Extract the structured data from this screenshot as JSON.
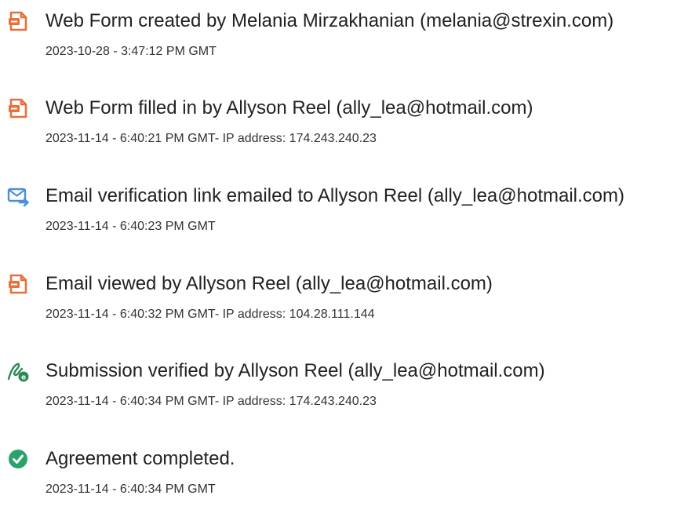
{
  "colors": {
    "doc_icon": "#e8703a",
    "email_icon": "#4a90d9",
    "verify_icon": "#2e8b57",
    "complete_icon": "#29a36a",
    "text": "#222222"
  },
  "events": [
    {
      "icon": "document-icon",
      "title": "Web Form created by Melania Mirzakhanian (melania@strexin.com)",
      "meta": "2023-10-28 - 3:47:12 PM GMT"
    },
    {
      "icon": "document-icon",
      "title": "Web Form filled in by Allyson Reel (ally_lea@hotmail.com)",
      "meta": "2023-11-14 - 6:40:21 PM GMT- IP address: 174.243.240.23"
    },
    {
      "icon": "email-send-icon",
      "title": "Email verification link emailed to Allyson Reel (ally_lea@hotmail.com)",
      "meta": "2023-11-14 - 6:40:23 PM GMT"
    },
    {
      "icon": "document-icon",
      "title": "Email viewed by Allyson Reel (ally_lea@hotmail.com)",
      "meta": "2023-11-14 - 6:40:32 PM GMT- IP address: 104.28.111.144"
    },
    {
      "icon": "signature-verified-icon",
      "title": "Submission verified by Allyson Reel (ally_lea@hotmail.com)",
      "meta": "2023-11-14 - 6:40:34 PM GMT- IP address: 174.243.240.23"
    },
    {
      "icon": "check-circle-icon",
      "title": "Agreement completed.",
      "meta": "2023-11-14 - 6:40:34 PM GMT"
    }
  ]
}
